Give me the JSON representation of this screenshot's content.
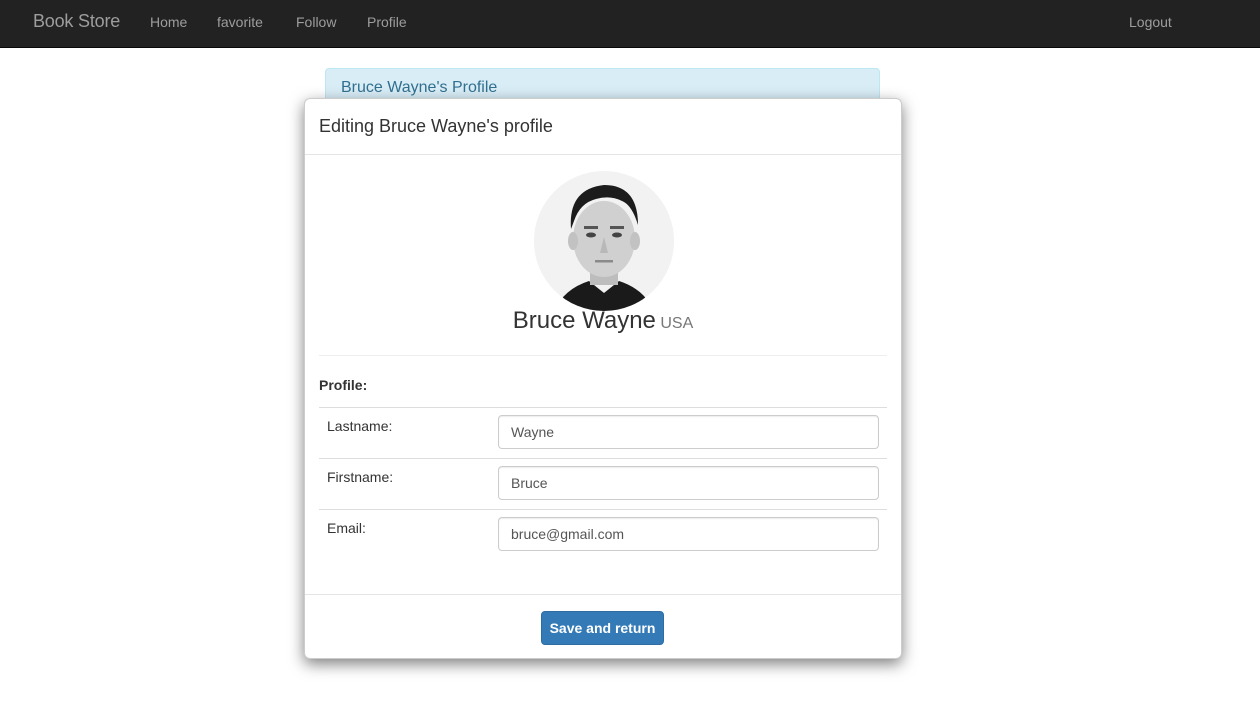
{
  "navbar": {
    "brand": "Book Store",
    "links": [
      "Home",
      "favorite",
      "Follow",
      "Profile"
    ],
    "logout": "Logout"
  },
  "background_panel": {
    "title": "Bruce Wayne's Profile"
  },
  "modal": {
    "title": "Editing Bruce Wayne's profile",
    "user": {
      "name": "Bruce Wayne",
      "country": "USA"
    },
    "section_label": "Profile:",
    "fields": [
      {
        "label": "Lastname:",
        "value": "Wayne"
      },
      {
        "label": "Firstname:",
        "value": "Bruce"
      },
      {
        "label": "Email:",
        "value": "bruce@gmail.com"
      }
    ],
    "save_button": "Save and return"
  }
}
